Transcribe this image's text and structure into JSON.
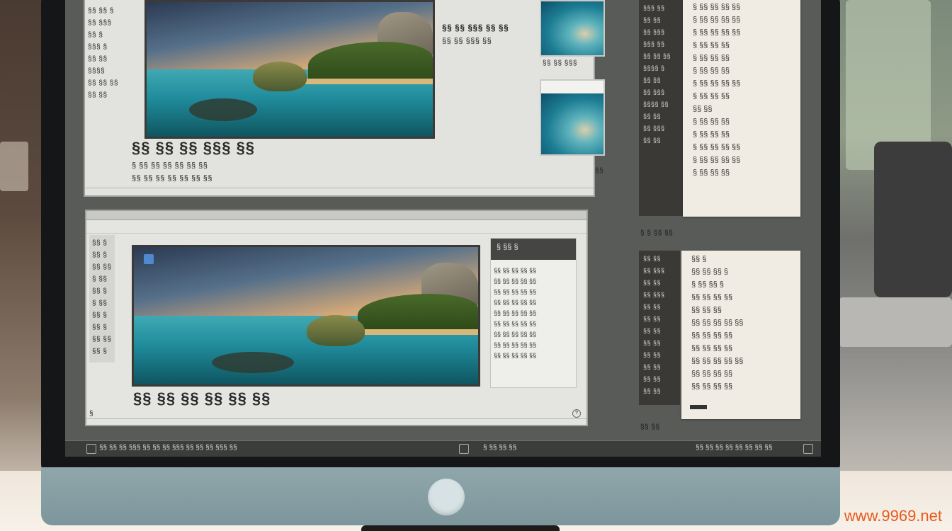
{
  "window1": {
    "side_items": [
      "§§ §§ §",
      "§§ §§§",
      "§§ §",
      "§§§ §",
      "§§ §§",
      "§§§§",
      "§§ §§ §§",
      "§§ §§"
    ],
    "caption": "§§ §§ §§ §§§ §§",
    "sub_line_1": "§ §§ §§ §§ §§ §§ §§",
    "sub_line_2": "§§ §§ §§ §§ §§ §§ §§",
    "mid_title": "§§ §§ §§§ §§ §§",
    "mid_sub": "§§ §§ §§§ §§",
    "thumb1_label": "§§ §§ §§§",
    "corner_number": "§§"
  },
  "doc_panel_1": {
    "list": [
      "§§§ §§",
      "§§ §§",
      "§§ §§§",
      "§§§ §§",
      "§§ §§ §§",
      "§§§§ §",
      "§§ §§",
      "§§ §§§",
      "§§§§ §§",
      "§§ §§",
      "§§ §§§",
      "§§ §§"
    ],
    "paper_lines": [
      "§ §§ §§ §§ §§",
      "§ §§ §§ §§ §§",
      "§ §§ §§ §§ §§",
      "§ §§ §§ §§",
      "§ §§ §§ §§",
      "§ §§ §§ §§",
      "§ §§ §§ §§ §§",
      "§ §§ §§ §§",
      "§§ §§",
      "§ §§ §§ §§",
      "§ §§ §§ §§",
      "§ §§ §§ §§ §§",
      "§ §§ §§ §§ §§",
      "§ §§ §§ §§"
    ]
  },
  "mid_label": "§ § §§ §§",
  "window2": {
    "side_items": [
      "§§ §",
      "§§ §",
      "§§ §§",
      "§ §§",
      "§§ §",
      "§ §§",
      "§§ §",
      "§§ §",
      "§§ §§",
      "§§ §"
    ],
    "caption": "§§ §§ §§ §§ §§ §§",
    "panel_head": "§ §§  §",
    "panel_grid": "§§ §§ §§ §§ §§\n§§ §§ §§ §§ §§\n§§ §§ §§ §§ §§\n§§ §§ §§ §§ §§\n§§ §§ §§ §§ §§\n§§ §§ §§ §§ §§\n§§ §§ §§ §§ §§\n§§ §§ §§ §§ §§\n§§ §§ §§ §§ §§",
    "footer": "§"
  },
  "doc_panel_2": {
    "list": [
      "§§ §§",
      "§§ §§§",
      "§§ §§",
      "§§ §§§",
      "§§ §§",
      "§§ §§",
      "§§ §§",
      "§§ §§",
      "§§ §§",
      "§§ §§",
      "§§ §§",
      "§§ §§"
    ],
    "paper_lines": [
      "§§ §",
      "§§ §§ §§ §",
      "§ §§ §§ §",
      "§§ §§ §§ §§",
      "§§ §§ §§",
      "§§ §§ §§ §§ §§",
      "§§ §§ §§ §§",
      "§§ §§ §§ §§",
      "§§ §§ §§ §§ §§",
      "§§ §§ §§ §§",
      "§§ §§ §§ §§"
    ]
  },
  "bottom_label": "§§ §§",
  "taskbar": {
    "left_text": "§§ §§ §§ §§§ §§ §§ §§ §§§ §§ §§ §§ §§§ §§",
    "right_text": "§ §§ §§ §§",
    "tray_text": "§§ §§ §§ §§ §§ §§ §§ §§"
  },
  "watermark": "www.9969.net"
}
